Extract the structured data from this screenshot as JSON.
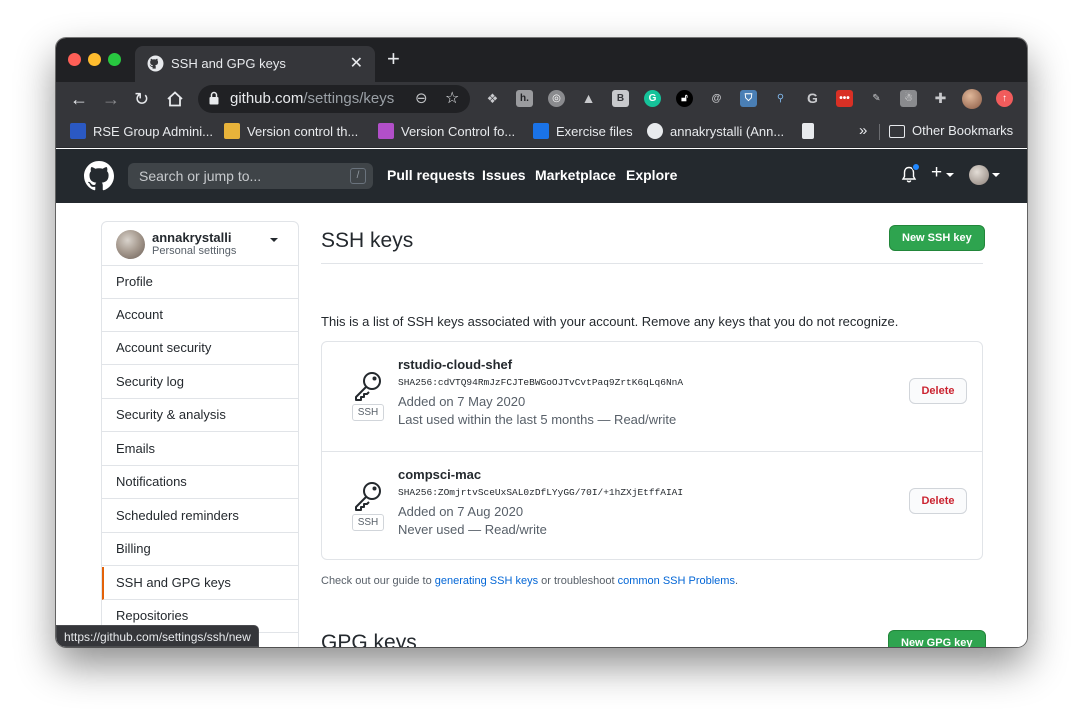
{
  "browser": {
    "tab_title": "SSH and GPG keys",
    "url_host": "github.com",
    "url_path": "/settings/keys",
    "status_url": "https://github.com/settings/ssh/new"
  },
  "bookmarks": {
    "items": [
      "RSE Group Admini...",
      "Version control th...",
      "Version Control fo...",
      "Exercise files",
      "annakrystalli (Ann..."
    ],
    "overflow": "»",
    "other": "Other Bookmarks"
  },
  "github_header": {
    "search_placeholder": "Search or jump to...",
    "search_key": "/",
    "nav": [
      "Pull requests",
      "Issues",
      "Marketplace",
      "Explore"
    ],
    "plus": "+"
  },
  "sidebar": {
    "username": "annakrystalli",
    "subtitle": "Personal settings",
    "items": [
      "Profile",
      "Account",
      "Account security",
      "Security log",
      "Security & analysis",
      "Emails",
      "Notifications",
      "Scheduled reminders",
      "Billing",
      "SSH and GPG keys",
      "Repositories"
    ],
    "selected": "SSH and GPG keys"
  },
  "ssh": {
    "title": "SSH keys",
    "new_button": "New SSH key",
    "description": "This is a list of SSH keys associated with your account. Remove any keys that you do not recognize.",
    "keys": [
      {
        "name": "rstudio-cloud-shef",
        "fingerprint": "SHA256:cdVTQ94RmJzFCJTeBWGoOJTvCvtPaq9ZrtK6qLq6NnA",
        "added": "Added on 7 May 2020",
        "usage": "Last used within the last 5 months — Read/write",
        "type": "SSH",
        "delete": "Delete"
      },
      {
        "name": "compsci-mac",
        "fingerprint": "SHA256:ZOmjrtvSceUxSAL0zDfLYyGG/70I/+1hZXjEtffAIAI",
        "added": "Added on 7 Aug 2020",
        "usage": "Never used — Read/write",
        "type": "SSH",
        "delete": "Delete"
      }
    ],
    "guide_prefix": "Check out our guide to ",
    "guide_link1": "generating SSH keys",
    "guide_middle": " or troubleshoot ",
    "guide_link2": "common SSH Problems",
    "guide_suffix": "."
  },
  "gpg": {
    "title": "GPG keys",
    "new_button": "New GPG key"
  }
}
